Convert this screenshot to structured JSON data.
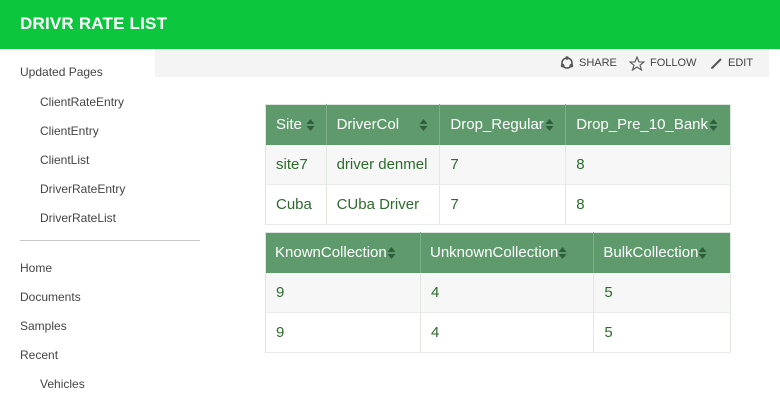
{
  "header": {
    "title": "DRIVR RATE LIST"
  },
  "actions": {
    "share": "SHARE",
    "follow": "FOLLOW",
    "edit": "EDIT"
  },
  "sidebar": {
    "group1": {
      "title": "Updated Pages",
      "items": [
        "ClientRateEntry",
        "ClientEntry",
        "ClientList",
        "DriverRateEntry",
        "DriverRateList"
      ]
    },
    "group2": {
      "items": [
        "Home",
        "Documents",
        "Samples",
        "Recent"
      ],
      "sub_items": [
        "Vehicles"
      ]
    }
  },
  "table1": {
    "columns": [
      "Site",
      "DriverCol",
      "Drop_Regular",
      "Drop_Pre_10_Bank"
    ],
    "rows": [
      [
        "site7",
        "driver denmel",
        "7",
        "8"
      ],
      [
        "Cuba",
        "CUba Driver",
        "7",
        "8"
      ]
    ]
  },
  "table2": {
    "columns": [
      "KnownCollection",
      "UnknownCollection",
      "BulkCollection"
    ],
    "rows": [
      [
        "9",
        "4",
        "5"
      ],
      [
        "9",
        "4",
        "5"
      ]
    ]
  },
  "colors": {
    "brand": "#0cc63e",
    "table_header": "#5f9a6c",
    "cell_text": "#2d6b2d"
  }
}
